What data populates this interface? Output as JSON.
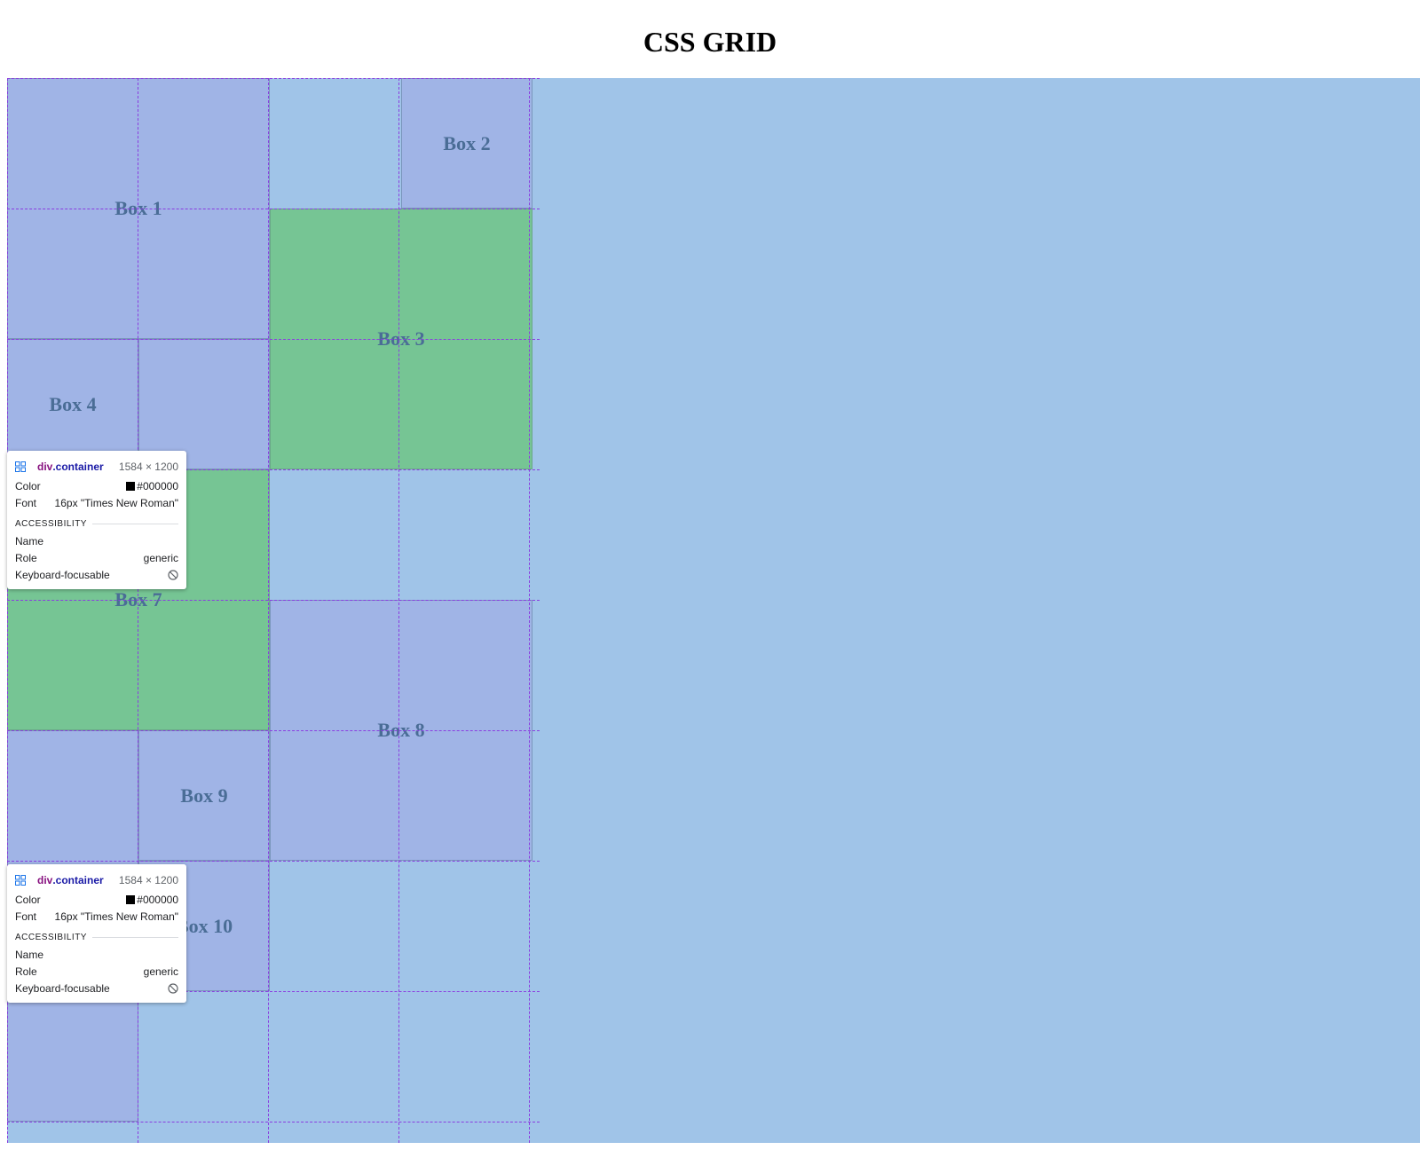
{
  "page": {
    "title": "CSS GRID"
  },
  "colors": {
    "container_bg": "#a0c4e8",
    "box_blue": "#a0b4e6",
    "box_green": "#76c594",
    "box_text": "#4a6d96",
    "grid_line": "#8a3ee0"
  },
  "boxes": [
    {
      "label": "Box 1",
      "color": "blue"
    },
    {
      "label": "Box 2",
      "color": "blue"
    },
    {
      "label": "Box 3",
      "color": "green"
    },
    {
      "label": "Box 4",
      "color": "blue"
    },
    {
      "label": "",
      "color": "blue"
    },
    {
      "label": "Box 7",
      "color": "green"
    },
    {
      "label": "Box 8",
      "color": "blue"
    },
    {
      "label": "",
      "color": "blue"
    },
    {
      "label": "Box 9",
      "color": "blue"
    },
    {
      "label": "Box 10",
      "color": "blue"
    },
    {
      "label": "",
      "color": "blue"
    }
  ],
  "tooltips": [
    {
      "element_tag": "div",
      "element_class": ".container",
      "dimensions": "1584 × 1200",
      "color_label": "Color",
      "color_value": "#000000",
      "font_label": "Font",
      "font_value": "16px \"Times New Roman\"",
      "section_label": "ACCESSIBILITY",
      "name_label": "Name",
      "name_value": "",
      "role_label": "Role",
      "role_value": "generic",
      "focusable_label": "Keyboard-focusable",
      "focusable_icon": "not-allowed-icon"
    },
    {
      "element_tag": "div",
      "element_class": ".container",
      "dimensions": "1584 × 1200",
      "color_label": "Color",
      "color_value": "#000000",
      "font_label": "Font",
      "font_value": "16px \"Times New Roman\"",
      "section_label": "ACCESSIBILITY",
      "name_label": "Name",
      "name_value": "",
      "role_label": "Role",
      "role_value": "generic",
      "focusable_label": "Keyboard-focusable",
      "focusable_icon": "not-allowed-icon"
    }
  ]
}
